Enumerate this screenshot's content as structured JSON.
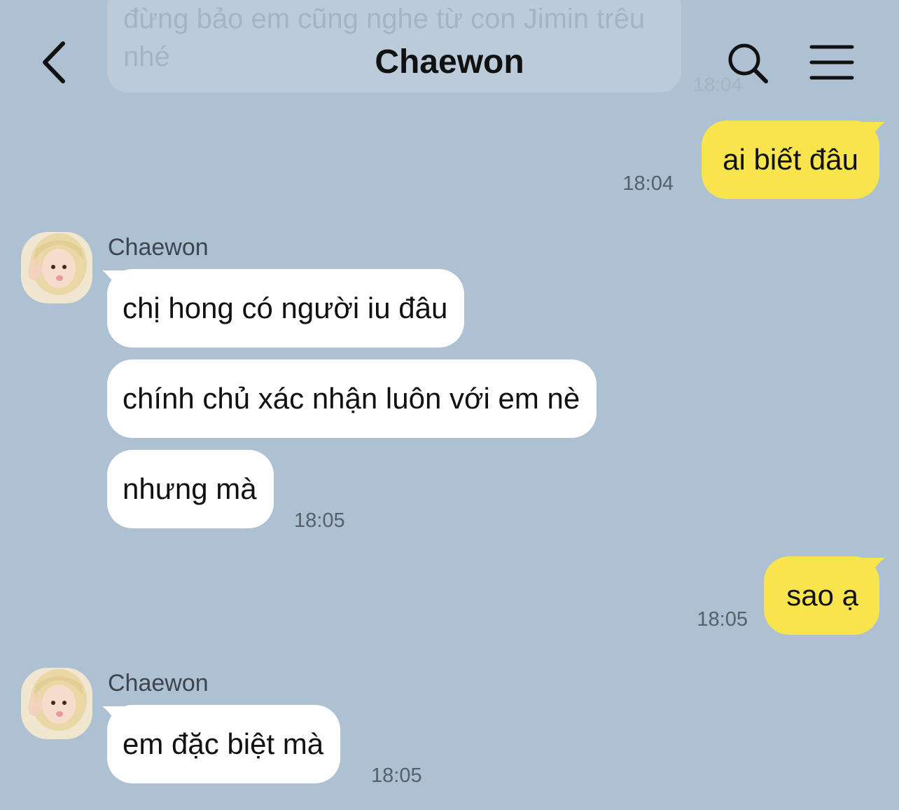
{
  "header": {
    "title": "Chaewon"
  },
  "icons": {
    "back": "chevron-left-icon",
    "search": "search-icon",
    "menu": "menu-icon"
  },
  "colors": {
    "background": "#aec1d2",
    "outgoing_bubble": "#f8e44d",
    "incoming_bubble": "#ffffff"
  },
  "faded_message": {
    "text": "đừng bảo em cũng nghe từ con Jimin trêu nhé",
    "time": "18:04"
  },
  "messages": [
    {
      "direction": "out",
      "text": "ai biết đâu",
      "time": "18:04"
    },
    {
      "direction": "in",
      "sender": "Chaewon",
      "texts": [
        "chị hong có người iu đâu",
        "chính chủ xác nhận luôn với em nè",
        "nhưng mà"
      ],
      "time": "18:05"
    },
    {
      "direction": "out",
      "text": "sao ạ",
      "time": "18:05"
    },
    {
      "direction": "in",
      "sender": "Chaewon",
      "texts": [
        "em đặc biệt mà"
      ],
      "time": "18:05"
    }
  ]
}
